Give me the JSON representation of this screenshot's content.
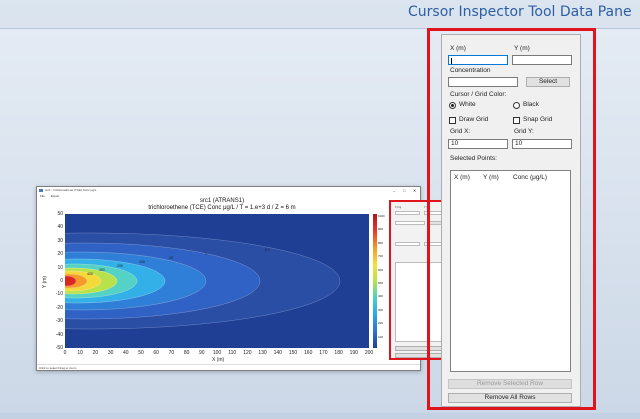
{
  "headline": "Cursor Inspector Tool Data Pane",
  "app_window": {
    "title": "src1 - trichloroethene (TCE) Conc μg/L",
    "menu": [
      "File",
      "Export"
    ],
    "plot_title_line1": "src1 (ATRANS1)",
    "plot_title_line2": "trichloroethene (TCE) Conc μg/L  /  T = 1.e+3 d  /  Z = 6 m",
    "statusbar": "Click to select   Drag to zoom"
  },
  "chart_data": {
    "type": "heatmap",
    "title": "src1 (ATRANS1)",
    "subtitle": "trichloroethene (TCE) Conc μg/L  /  T = 1.e+3 d  /  Z = 6 m",
    "xlabel": "X (m)",
    "ylabel": "Y (m)",
    "xlim": [
      0,
      200
    ],
    "ylim": [
      -50,
      50
    ],
    "x_ticks": [
      "0",
      "10",
      "20",
      "30",
      "40",
      "50",
      "60",
      "70",
      "80",
      "90",
      "100",
      "110",
      "120",
      "130",
      "140",
      "150",
      "160",
      "170",
      "180",
      "190",
      "200"
    ],
    "y_ticks": [
      "50",
      "40",
      "30",
      "20",
      "10",
      "0",
      "-10",
      "-20",
      "-30",
      "-40",
      "-50"
    ],
    "colorbar_ticks": [
      "1000",
      "900",
      "800",
      "700",
      "600",
      "500",
      "400",
      "300",
      "200",
      "100"
    ],
    "contour_labels": [
      "400",
      "300",
      "200",
      "100",
      "10",
      "1",
      "0.1"
    ]
  },
  "pane": {
    "x_label": "X (m)",
    "y_label": "Y (m)",
    "x_value": "",
    "y_value": "",
    "concentration_label": "Concentration",
    "concentration_value": "",
    "select_button": "Select",
    "color_label": "Cursor / Grid Color:",
    "radio_white": "White",
    "radio_black": "Black",
    "color_selected": "White",
    "draw_grid_label": "Draw Grid",
    "snap_grid_label": "Snap Grid",
    "grid_x_label": "Grid X:",
    "grid_y_label": "Grid Y:",
    "grid_x_value": "10",
    "grid_y_value": "10",
    "selected_points_label": "Selected Points:",
    "columns": [
      "X (m)",
      "Y (m)",
      "Conc (μg/L)"
    ],
    "remove_selected_button": "Remove Selected Row",
    "remove_all_button": "Remove All Rows"
  },
  "colors": {
    "highlight": "#e0141d",
    "headline": "#2e5fa3",
    "plot_background": "#1f3f95"
  }
}
